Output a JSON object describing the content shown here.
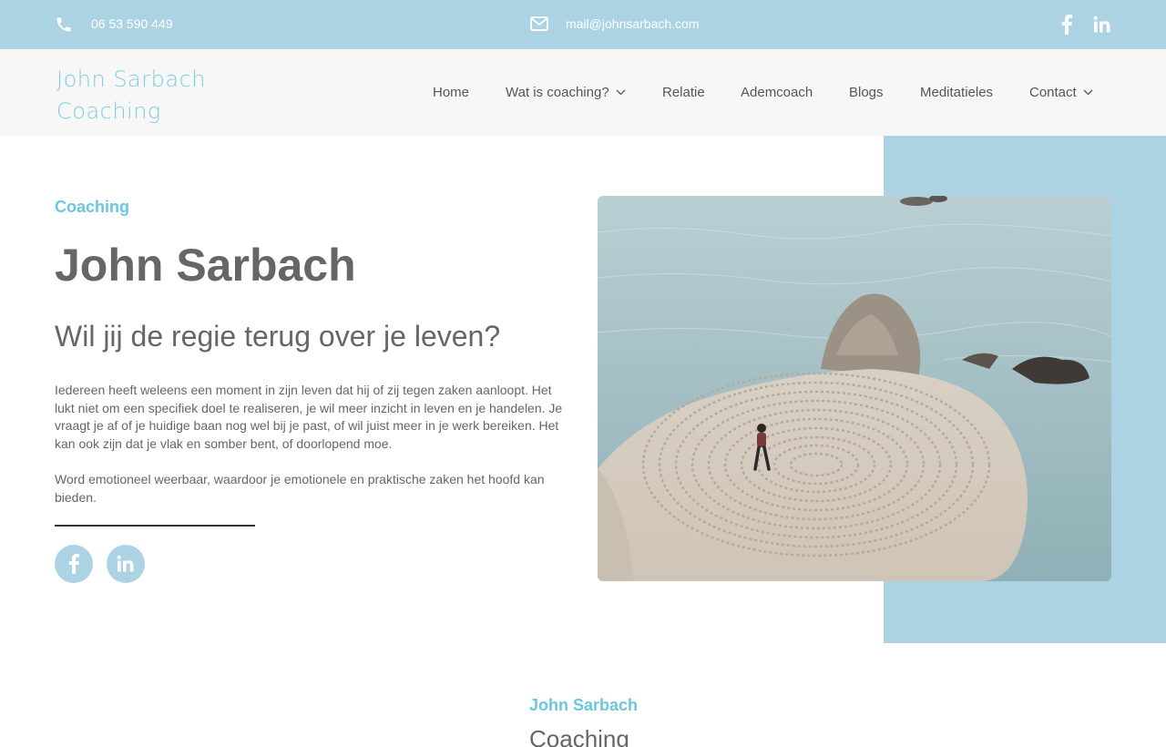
{
  "topbar": {
    "phone": "06 53 590 449",
    "email": "mail@johnsarbach.com",
    "phone_icon": "phone-icon",
    "email_icon": "envelope-icon",
    "social_icons": [
      "facebook-icon",
      "linkedin-icon"
    ]
  },
  "header": {
    "logo_line1": "John Sarbach",
    "logo_line2": "Coaching",
    "nav": [
      {
        "label": "Home"
      },
      {
        "label": "Wat is coaching?",
        "has_dropdown": true
      },
      {
        "label": "Relatie"
      },
      {
        "label": "Ademcoach"
      },
      {
        "label": "Blogs"
      },
      {
        "label": "Meditatieles"
      },
      {
        "label": "Contact",
        "has_dropdown": true
      }
    ]
  },
  "hero": {
    "eyebrow": "Coaching",
    "title": "John Sarbach",
    "subtitle": "Wil jij de regie terug over je leven?",
    "paragraph1": "Iedereen heeft weleens een moment in zijn leven dat hij of zij tegen zaken aanloopt. Het lukt niet om een specifiek doel te realiseren, je wil meer inzicht in leven en je handelen. Je vraagt je af of je huidige baan nog wel bij je past, of wil juist meer in je werk bereiken. Het kan ook zijn dat je vlak en somber bent, of doorlopend moe.",
    "paragraph2": "Word emotioneel weerbaar, waardoor je emotionele en praktische zaken het hoofd kan bieden.",
    "social_icons": [
      "facebook-icon",
      "linkedin-icon"
    ]
  },
  "section2": {
    "eyebrow": "John Sarbach",
    "title": "Coaching"
  },
  "colors": {
    "topbar_bg": "#acd3e4",
    "accent": "#6cc6df",
    "header_bg": "#f7f7f7",
    "text": "#666666"
  }
}
